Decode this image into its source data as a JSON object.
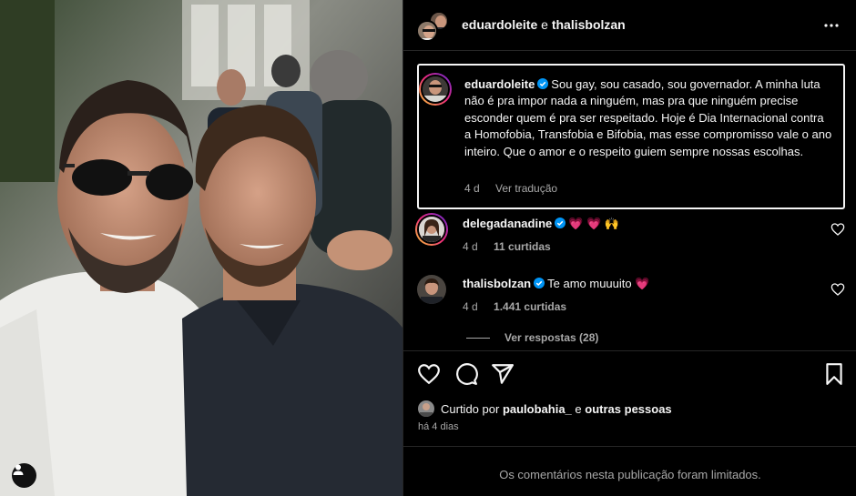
{
  "post": {
    "header": {
      "author": "eduardoleite",
      "connector": "e",
      "collaborator": "thalisbolzan"
    },
    "caption": {
      "username": "eduardoleite",
      "verified": true,
      "text": "Sou gay, sou casado, sou governador. A minha luta não é pra impor nada a ninguém, mas pra que ninguém precise esconder quem é pra ser respeitado. Hoje é Dia Internacional contra a Homofobia, Transfobia e Bifobia, mas esse compromisso vale o ano inteiro. Que o amor e o respeito guiem sempre nossas escolhas.",
      "time": "4 d",
      "translate_label": "Ver tradução"
    },
    "comments": [
      {
        "username": "delegadanadine",
        "verified": true,
        "text": "💗 💗 🙌",
        "time": "4 d",
        "likes": "11 curtidas"
      },
      {
        "username": "thalisbolzan",
        "verified": true,
        "text": "Te amo muuuito 💗",
        "time": "4 d",
        "likes": "1.441 curtidas"
      }
    ],
    "view_replies": "Ver respostas (28)",
    "liked_by": {
      "prefix": "Curtido por",
      "user": "paulobahia_",
      "connector": "e",
      "others": "outras pessoas"
    },
    "posted_ago": "há 4 dias",
    "comments_limited": "Os comentários nesta publicação foram limitados.",
    "icons": {
      "more": "more-options-icon",
      "like": "heart-icon",
      "comment": "comment-icon",
      "share": "share-icon",
      "save": "bookmark-icon",
      "tags": "user-tag-icon",
      "verified": "verified-badge-icon"
    },
    "colors": {
      "verified": "#0095f6",
      "heart_emoji": "#ff3f6c",
      "muted": "#a8a8a8"
    }
  }
}
